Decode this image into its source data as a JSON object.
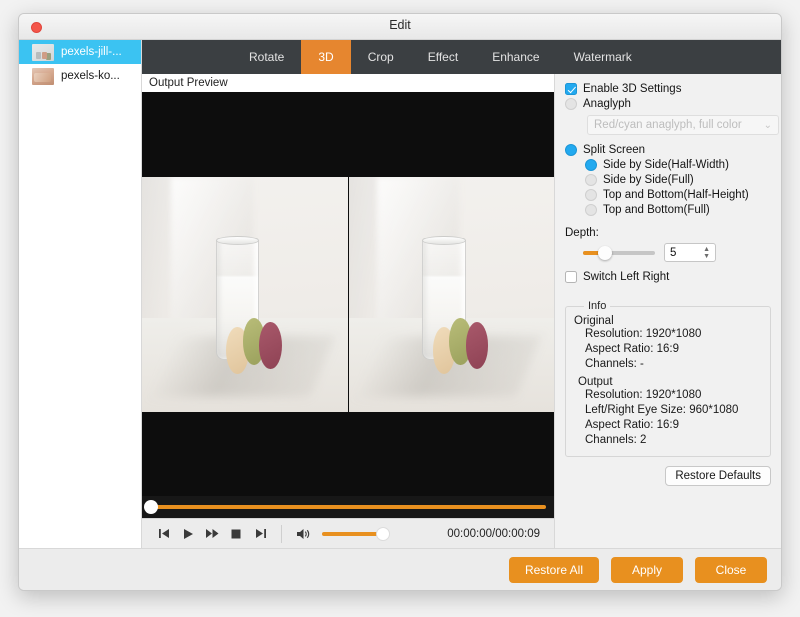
{
  "window": {
    "title": "Edit",
    "close_icon": "close-dot-icon"
  },
  "sidebar": {
    "files": [
      {
        "name": "pexels-jill-...",
        "selected": true
      },
      {
        "name": "pexels-ko...",
        "selected": false
      }
    ]
  },
  "tabs": [
    {
      "label": "Rotate",
      "active": false
    },
    {
      "label": "3D",
      "active": true
    },
    {
      "label": "Crop",
      "active": false
    },
    {
      "label": "Effect",
      "active": false
    },
    {
      "label": "Enhance",
      "active": false
    },
    {
      "label": "Watermark",
      "active": false
    }
  ],
  "preview": {
    "label": "Output Preview",
    "time_display": "00:00:00/00:00:09",
    "seek_position_percent": 0,
    "volume_percent": 100,
    "controls": [
      "previous-icon",
      "play-icon",
      "fast-forward-icon",
      "stop-icon",
      "next-icon"
    ],
    "volume_icon": "speaker-icon"
  },
  "settings": {
    "enable_3d": {
      "label": "Enable 3D Settings",
      "checked": true
    },
    "anaglyph": {
      "label": "Anaglyph",
      "selected": false
    },
    "anaglyph_select": {
      "value": "Red/cyan anaglyph, full color",
      "chevron": "⌄",
      "disabled": true
    },
    "split_screen": {
      "label": "Split Screen",
      "selected": true
    },
    "split_options": [
      {
        "label": "Side by Side(Half-Width)",
        "selected": true
      },
      {
        "label": "Side by Side(Full)",
        "selected": false
      },
      {
        "label": "Top and Bottom(Half-Height)",
        "selected": false
      },
      {
        "label": "Top and Bottom(Full)",
        "selected": false
      }
    ],
    "depth": {
      "label": "Depth:",
      "value": "5",
      "slider_percent": 22
    },
    "switch_left_right": {
      "label": "Switch Left Right",
      "checked": false
    },
    "info": {
      "legend": "Info",
      "original_head": "Original",
      "original_lines": [
        "Resolution: 1920*1080",
        "Aspect Ratio: 16:9",
        "Channels: -"
      ],
      "output_head": "Output",
      "output_lines": [
        "Resolution: 1920*1080",
        "Left/Right Eye Size: 960*1080",
        "Aspect Ratio: 16:9",
        "Channels: 2"
      ]
    },
    "restore_defaults_label": "Restore Defaults"
  },
  "footer": {
    "restore_all_label": "Restore All",
    "apply_label": "Apply",
    "close_label": "Close"
  },
  "colors": {
    "accent_orange": "#e8901f",
    "tab_active_orange": "#e6862f",
    "selection_blue": "#3bc3f2",
    "control_blue": "#22a9ef"
  }
}
